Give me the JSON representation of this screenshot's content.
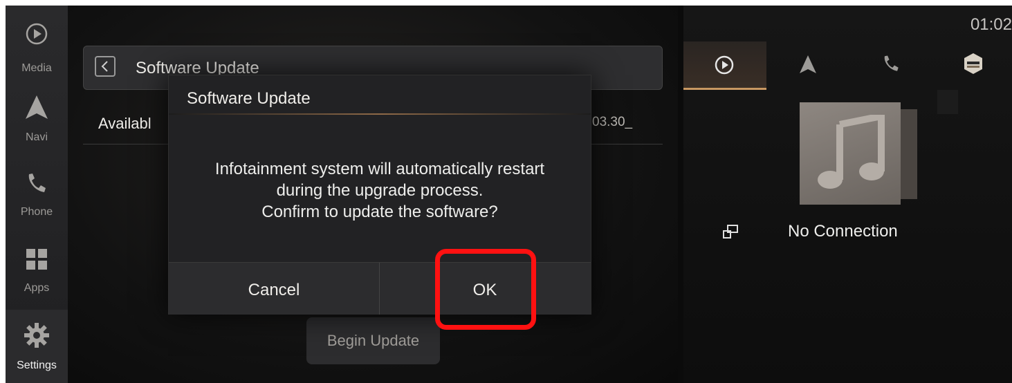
{
  "nav": {
    "items": [
      {
        "label": "Media",
        "icon": "play-circle-icon"
      },
      {
        "label": "Navi",
        "icon": "navigation-arrow-icon"
      },
      {
        "label": "Phone",
        "icon": "phone-icon"
      },
      {
        "label": "Apps",
        "icon": "apps-grid-icon"
      },
      {
        "label": "Settings",
        "icon": "gear-icon",
        "active": true
      }
    ]
  },
  "main": {
    "header_title": "Software Update",
    "available_label": "Availabl",
    "version_text": "03.30_",
    "begin_update_label": "Begin Update"
  },
  "dialog": {
    "title": "Software Update",
    "message_lines": [
      "Infotainment system will automatically restart",
      "during the upgrade process.",
      "Confirm to update the software?"
    ],
    "cancel_label": "Cancel",
    "ok_label": "OK"
  },
  "right_panel": {
    "time": "01:02",
    "tabs": [
      "play-circle-icon",
      "navigation-arrow-icon",
      "phone-icon",
      "car-icon"
    ],
    "no_connection_label": "No Connection"
  },
  "colors": {
    "accent": "#c99862",
    "highlight": "#ff1111"
  }
}
